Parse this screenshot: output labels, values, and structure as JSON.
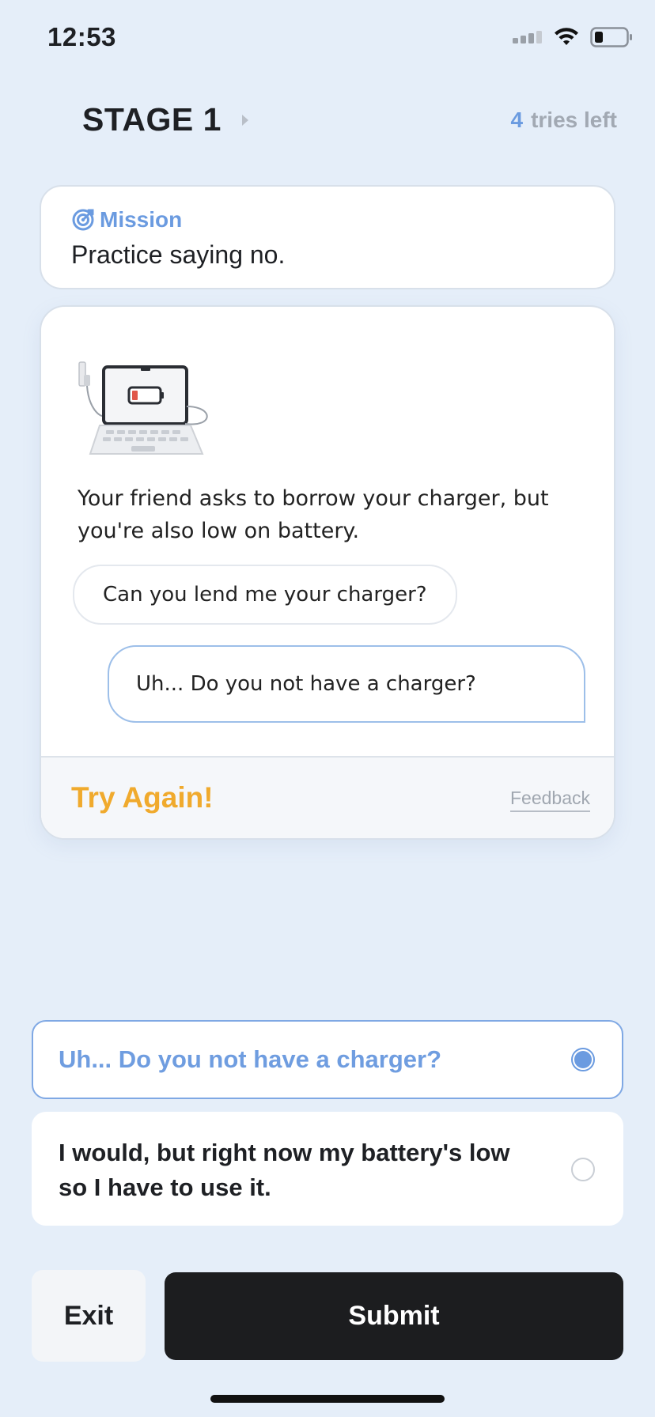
{
  "status_bar": {
    "time": "12:53"
  },
  "header": {
    "stage_label": "STAGE 1",
    "tries_count": "4",
    "tries_suffix": "tries left"
  },
  "mission": {
    "label": "Mission",
    "text": "Practice saying no."
  },
  "scenario": {
    "description": "Your friend asks to borrow your charger, but you're also low on battery.",
    "friend_message": "Can you lend me your charger?",
    "user_reply": "Uh... Do you not have a charger?",
    "result_label": "Try Again!",
    "feedback_link": "Feedback"
  },
  "options": [
    {
      "text": "Uh... Do you not have a charger?",
      "selected": true
    },
    {
      "text": "I would, but right now my battery's low so I have to use it.",
      "selected": false
    }
  ],
  "buttons": {
    "exit": "Exit",
    "submit": "Submit"
  },
  "colors": {
    "accent": "#6b9be0",
    "warning": "#f0aa2d",
    "background": "#e5eef9",
    "primary_button": "#1c1d1f"
  }
}
